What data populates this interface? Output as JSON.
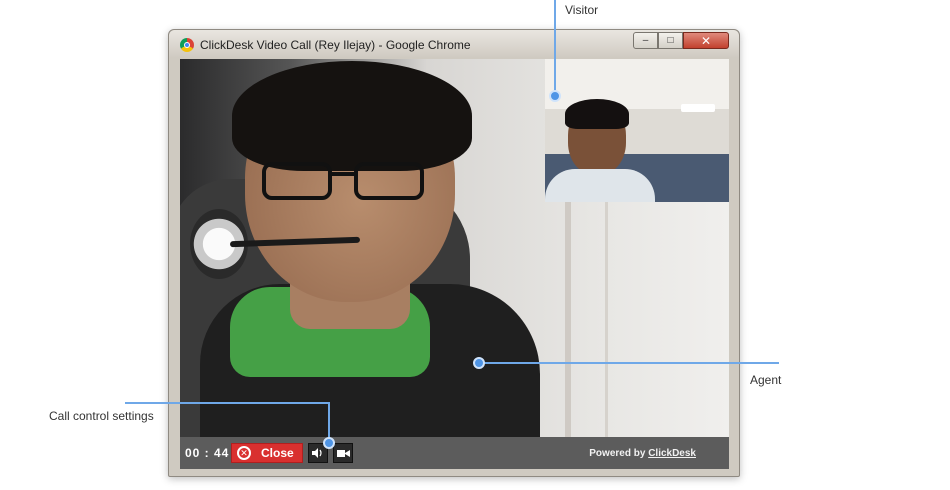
{
  "annotations": {
    "visitor": "Visitor",
    "agent": "Agent",
    "call_control": "Call control settings"
  },
  "window": {
    "title": "ClickDesk Video Call (Rey Ilejay) - Google Chrome",
    "controls": {
      "minimize": "–",
      "maximize": "□",
      "close": "✕"
    }
  },
  "controls": {
    "timer": "00 : 44",
    "close_label": "Close",
    "powered_prefix": "Powered by",
    "powered_link": "ClickDesk"
  },
  "colors": {
    "close_button": "#d9302f",
    "control_bar": "#5c5c5c",
    "annotation_line": "#6fa8e8"
  },
  "icons": [
    "chrome-logo-icon",
    "close-circle-icon",
    "speaker-icon",
    "camera-icon"
  ]
}
